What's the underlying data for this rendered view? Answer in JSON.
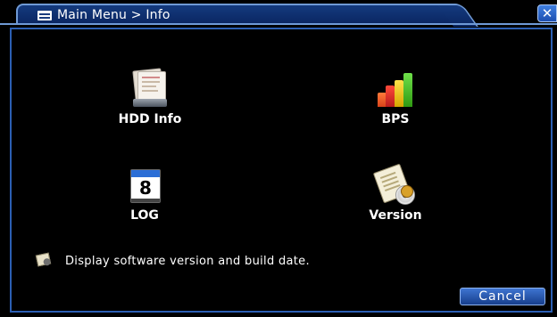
{
  "window": {
    "title": "Main Menu > Info",
    "title_icon": "menu-list-icon",
    "close_label": "✕"
  },
  "menu": {
    "items": [
      {
        "label": "HDD Info",
        "icon": "hdd-icon"
      },
      {
        "label": "BPS",
        "icon": "bps-bars-icon"
      },
      {
        "label": "LOG",
        "icon": "calendar-log-icon",
        "calendar_number": "8"
      },
      {
        "label": "Version",
        "icon": "version-cd-icon"
      }
    ]
  },
  "status": {
    "hint_icon": "note-icon",
    "text": "Display software version and build date."
  },
  "footer": {
    "cancel_label": "Cancel"
  },
  "colors": {
    "frame": "#2c5fb3",
    "title_border": "#6f9ad6",
    "background": "#000000",
    "button": "#1e4fb0"
  }
}
